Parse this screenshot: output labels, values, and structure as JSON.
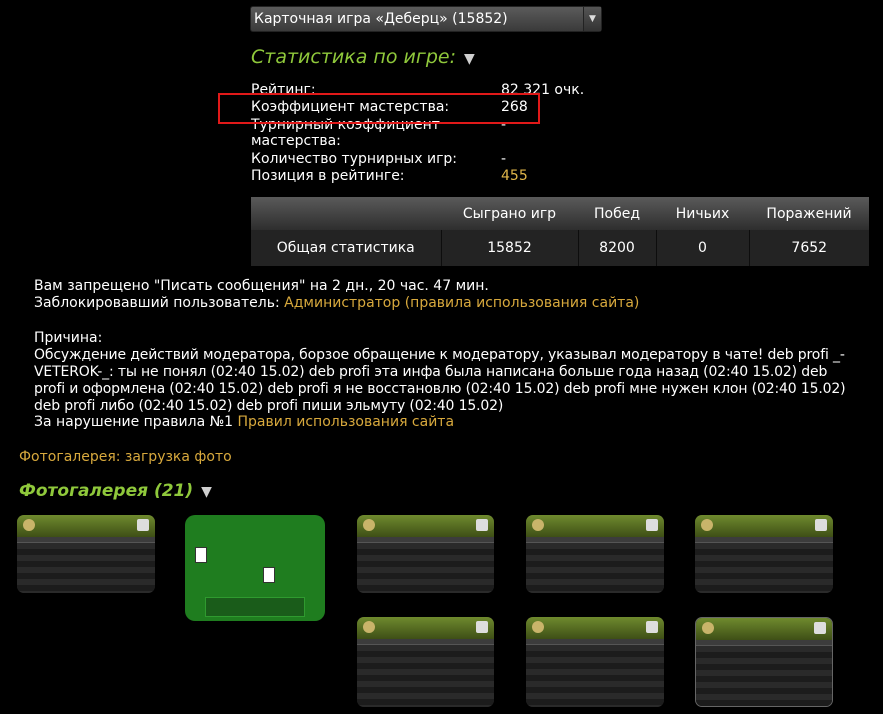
{
  "game_select": {
    "value": "Карточная игра «Деберц» (15852)"
  },
  "stats_section": {
    "title": "Статистика по игре:",
    "rows": [
      {
        "label": "Рейтинг:",
        "value": "82 321 очк."
      },
      {
        "label": "Коэффициент мастерства:",
        "value": "268"
      },
      {
        "label": "Турнирный коэффициент",
        "label2": "мастерства:",
        "value": "-"
      },
      {
        "label": "Количество турнирных игр:",
        "value": "-"
      },
      {
        "label": "Позиция в рейтинге:",
        "value": "455"
      }
    ]
  },
  "stats_table": {
    "headers": [
      "",
      "Сыграно игр",
      "Побед",
      "Ничьих",
      "Поражений"
    ],
    "row": [
      "Общая статистика",
      "15852",
      "8200",
      "0",
      "7652"
    ]
  },
  "ban": {
    "line1": "Вам запрещено \"Писать сообщения\" на 2 дн., 20 час. 47 мин.",
    "blocked_by_label": "Заблокировавший пользователь:",
    "blocked_by_link": "Администратор (правила использования сайта)",
    "reason_label": "Причина:",
    "reason_text": "Обсуждение действий модератора, борзое обращение к модератору, указывал модератору в чате! deb profi _-VETEROK-_: ты не понял (02:40 15.02) deb profi эта инфа была написана больше года назад (02:40 15.02) deb profi и оформлена (02:40 15.02) deb profi я не восстановлю (02:40 15.02) deb profi мне нужен клон (02:40 15.02) deb profi либо (02:40 15.02) deb profi пиши эльмуту (02:40 15.02)",
    "violation_label": "За нарушение правила №1",
    "violation_link": "Правил использования сайта"
  },
  "gallery": {
    "upload_link": "Фотогалерея: загрузка фото",
    "title": "Фотогалерея (21)"
  },
  "colors": {
    "accent_green": "#8fc83b",
    "link_gold": "#d8a93d",
    "highlight_red": "#e11919"
  }
}
